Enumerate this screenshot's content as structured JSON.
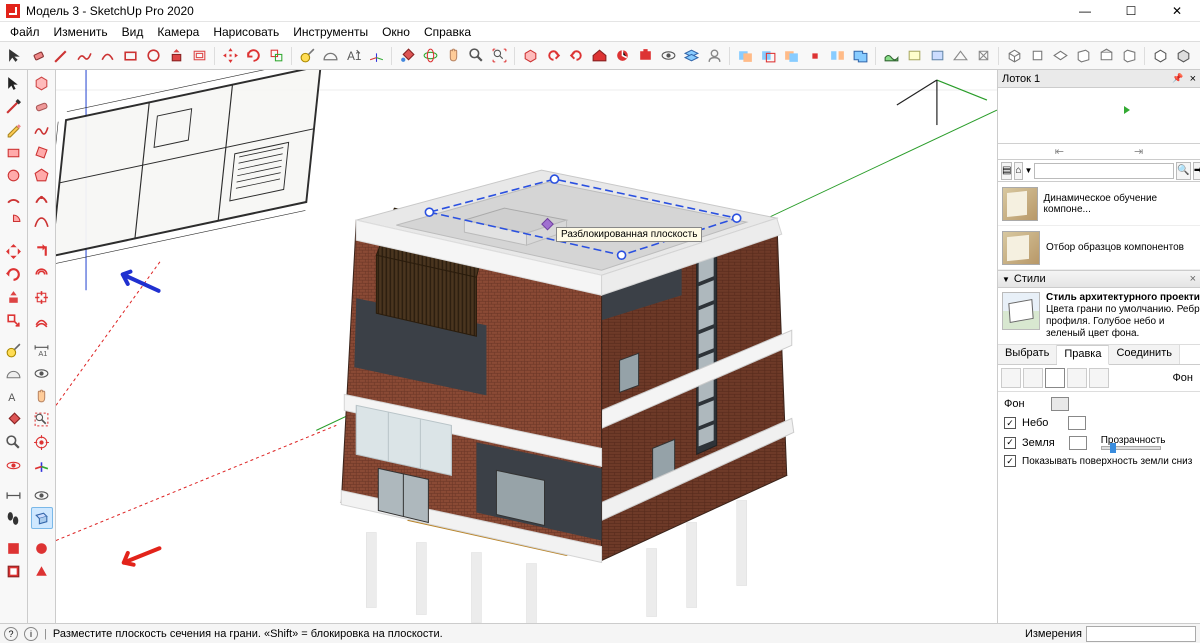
{
  "title": "Модель 3 - SketchUp Pro 2020",
  "menu": [
    "Файл",
    "Изменить",
    "Вид",
    "Камера",
    "Нарисовать",
    "Инструменты",
    "Окно",
    "Справка"
  ],
  "tray_title": "Лоток 1",
  "components": {
    "items": [
      {
        "label": "Динамическое обучение компоне..."
      },
      {
        "label": "Отбор образцов компонентов"
      }
    ]
  },
  "styles_section": "Стили",
  "style": {
    "name": "Стиль архитектурного проектир",
    "desc": "Цвета грани по умолчанию. Ребра профиля. Голубое небо и зеленый цвет фона."
  },
  "style_tabs": [
    "Выбрать",
    "Правка",
    "Соединить"
  ],
  "style_icons_label": "Фон",
  "bg": {
    "bg_label": "Фон",
    "sky_label": "Небо",
    "ground_label": "Земля",
    "transparency_label": "Прозрачность",
    "show_ground_label": "Показывать поверхность земли сниз"
  },
  "status": {
    "hint": "Разместите плоскость сечения на грани. «Shift» = блокировка на плоскости.",
    "measure_label": "Измерения"
  },
  "viewport": {
    "tooltip": "Разблокированная плоскость"
  },
  "win": {
    "min": "—",
    "max": "☐",
    "close": "✕"
  }
}
